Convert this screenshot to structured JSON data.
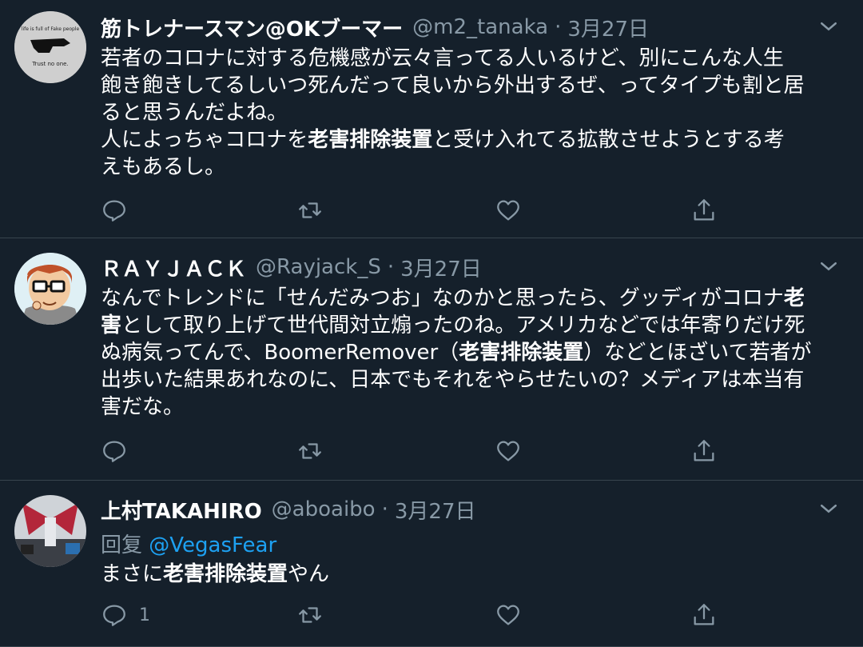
{
  "tweets": [
    {
      "name": "筋トレナースマン@OKブーマー",
      "handle": "@m2_tanaka",
      "date": "3月27日",
      "body_parts": [
        "若者のコロナに対する危機感が云々言ってる人いるけど、別にこんな人生\n飽き飽きしてるしいつ死んだって良いから外出するぜ、ってタイプも割と居\nると思うんだよね。\n人によっちゃコロナを",
        "老害排除装置",
        "と受け入れてる拡散させようとする考\nえもあるし。"
      ],
      "avatar_text_top": "life is full of Fake people",
      "avatar_text_bottom": "Trust no one.",
      "reply_count": ""
    },
    {
      "name": "ＲＡＹＪＡＣＫ",
      "handle": "@Rayjack_S",
      "date": "3月27日",
      "body_parts": [
        "なんでトレンドに「せんだみつお」なのかと思ったら、グッディがコロナ",
        "老\n害",
        "として取り上げて世代間対立煽ったのね。アメリカなどでは年寄りだけ死\nぬ病気ってんで、BoomerRemover（",
        "老害排除装置",
        "）などとほざいて若者が\n出歩いた結果あれなのに、日本でもそれをやらせたいの？メディアは本当有\n害だな。"
      ],
      "reply_count": ""
    },
    {
      "name": "上村TAKAHIRO",
      "handle": "@aboaibo",
      "date": "3月27日",
      "reply_prefix": "回复",
      "reply_mention": "@VegasFear",
      "body_parts": [
        "まさに",
        "老害排除装置",
        "やん"
      ],
      "reply_count": "1"
    }
  ],
  "icons": [
    "reply-icon",
    "retweet-icon",
    "like-icon",
    "share-icon",
    "chevron-down-icon"
  ],
  "colors": {
    "background": "#15202b",
    "secondary": "#8899a6",
    "link": "#1da1f2",
    "divider": "#38444d"
  }
}
